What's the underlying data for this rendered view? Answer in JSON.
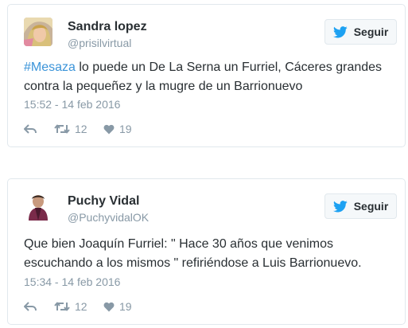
{
  "tweets": [
    {
      "display_name": "Sandra lopez",
      "handle": "@prisilvirtual",
      "follow_label": "Seguir",
      "text_hashtag": "#Mesaza",
      "text_body": " lo puede un De La Serna un Furriel, Cáceres grandes contra la pequeñez y la mugre de un Barrionuevo",
      "timestamp": "15:52 - 14 feb 2016",
      "retweets": "12",
      "likes": "19",
      "icons": {
        "reply": "reply-icon",
        "retweet": "retweet-icon",
        "like": "heart-icon",
        "follow": "twitter-bird-icon"
      }
    },
    {
      "display_name": "Puchy Vidal",
      "handle": "@PuchyvidalOK",
      "follow_label": "Seguir",
      "text_body": "Que bien Joaquín Furriel: \" Hace 30 años que venimos escuchando a los mismos \" refiriéndose a Luis Barrionuevo.",
      "timestamp": "15:34 - 14 feb 2016",
      "retweets": "12",
      "likes": "19",
      "icons": {
        "reply": "reply-icon",
        "retweet": "retweet-icon",
        "like": "heart-icon",
        "follow": "twitter-bird-icon"
      }
    }
  ],
  "colors": {
    "accent": "#1da1f2",
    "hashtag": "#3b94d9",
    "muted": "#8899a6",
    "text": "#292f33",
    "border": "#e1e8ed"
  }
}
